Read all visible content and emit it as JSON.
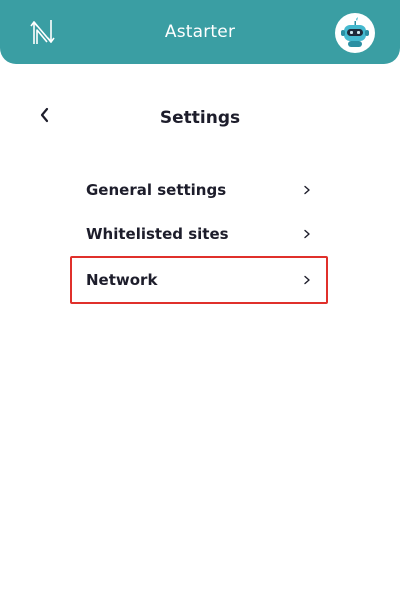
{
  "header": {
    "title": "Astarter",
    "logo_icon": "n-logo-icon",
    "avatar_icon": "robot-avatar-icon",
    "background": "#3a9ea3"
  },
  "page": {
    "title": "Settings",
    "back_icon": "chevron-left-icon"
  },
  "menu": {
    "items": [
      {
        "label": "General settings",
        "icon": "chevron-right-icon"
      },
      {
        "label": "Whitelisted sites",
        "icon": "chevron-right-icon"
      },
      {
        "label": "Network",
        "icon": "chevron-right-icon",
        "highlighted": true
      }
    ]
  },
  "colors": {
    "highlight_border": "#e0302b",
    "text": "#1d1d2b"
  }
}
